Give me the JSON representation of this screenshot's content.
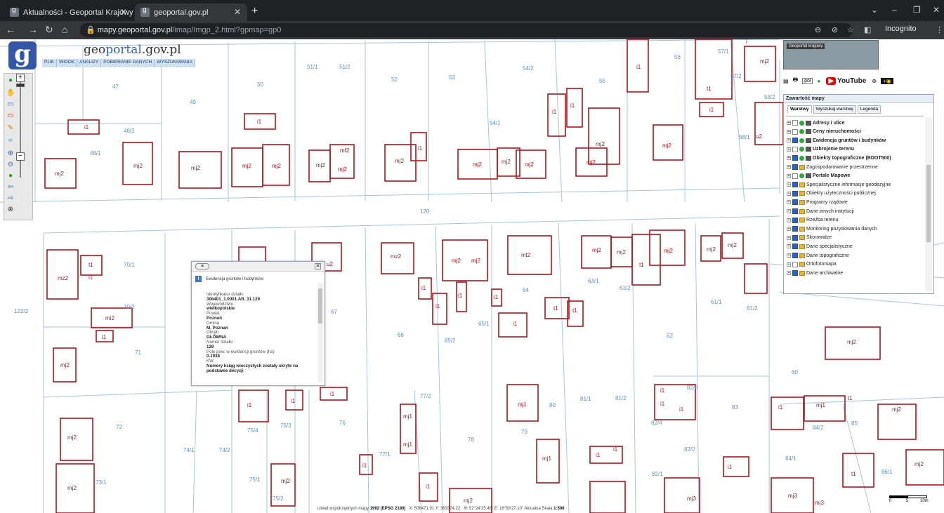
{
  "browser": {
    "tabs": [
      {
        "title": "Aktualności - Geoportal Krajowy"
      },
      {
        "title": "geoportal.gov.pl"
      }
    ],
    "url_host": "mapy.geoportal.gov.pl",
    "url_path": "/imap/Imgp_2.html?gpmap=gp0",
    "incognito_label": "Incognito"
  },
  "app": {
    "logo_letter": "g",
    "logo_text_a": "geo",
    "logo_text_b": "portal",
    "logo_text_c": ".gov.pl",
    "menu": [
      "PLIK",
      "WIDOK",
      "ANALIZY",
      "POBIERANIE DANYCH",
      "WYSZUKIWANIA"
    ]
  },
  "popup": {
    "section_title": "Ewidencja gruntów i budynków",
    "fields": [
      {
        "label": "Identyfikator działki",
        "value": "306401_1.0001.AR_31.129"
      },
      {
        "label": "Województwo",
        "value": "wielkopolskie"
      },
      {
        "label": "Powiat",
        "value": "Poznań"
      },
      {
        "label": "Gmina",
        "value": "M. Poznań"
      },
      {
        "label": "Obręb",
        "value": "GŁÓWNA"
      },
      {
        "label": "Numer działki",
        "value": "129"
      },
      {
        "label": "Pole pow. w ewidencji gruntów (ha)",
        "value": "0.1938"
      },
      {
        "label": "KW",
        "value": "Numery ksiąg wieczystych zostały ukryte na podstawie decyzji"
      }
    ]
  },
  "overview": {
    "label": "Geoportal krajowy"
  },
  "toolbar": {
    "lang": "pol",
    "youtube": "YouTube"
  },
  "panel": {
    "title": "Zawartość mapy",
    "tabs": [
      "Warstwy",
      "Wyszukaj warstwę",
      "Legenda"
    ],
    "layers": [
      {
        "name": "Adresy i ulice",
        "checked": false,
        "bold": true,
        "icon": "dot"
      },
      {
        "name": "Ceny nieruchomości",
        "checked": false,
        "bold": true,
        "icon": "dot"
      },
      {
        "name": "Ewidencja gruntów i budynków",
        "checked": true,
        "bold": true,
        "icon": "dot"
      },
      {
        "name": "Uzbrojenie terenu",
        "checked": false,
        "bold": true,
        "icon": "dot"
      },
      {
        "name": "Obiekty topograficzne (BDOT500)",
        "checked": true,
        "bold": true,
        "icon": "dot"
      },
      {
        "name": "Zagospodarowanie przestrzenne",
        "checked": true,
        "bold": false,
        "icon": "folder"
      },
      {
        "name": "Portale Mapowe",
        "checked": false,
        "bold": true,
        "icon": "dot"
      },
      {
        "name": "Specjalistyczne informacje geodezyjne",
        "checked": true,
        "bold": false,
        "icon": "folder"
      },
      {
        "name": "Obiekty użyteczności publicznej",
        "checked": true,
        "bold": false,
        "icon": "folder"
      },
      {
        "name": "Programy rządowe",
        "checked": true,
        "bold": false,
        "icon": "folder"
      },
      {
        "name": "Dane innych instytucji",
        "checked": true,
        "bold": false,
        "icon": "folder"
      },
      {
        "name": "Rzeźba terenu",
        "checked": true,
        "bold": false,
        "icon": "folder"
      },
      {
        "name": "Monitoring pozyskiwania danych",
        "checked": true,
        "bold": false,
        "icon": "folder"
      },
      {
        "name": "Skorowidze",
        "checked": true,
        "bold": false,
        "icon": "folder"
      },
      {
        "name": "Dane specjalistyczne",
        "checked": true,
        "bold": false,
        "icon": "folder"
      },
      {
        "name": "Dane topograficzne",
        "checked": true,
        "bold": false,
        "icon": "folder"
      },
      {
        "name": "Ortofotomapa",
        "checked": false,
        "bold": false,
        "icon": "folder"
      },
      {
        "name": "Dane archiwalne",
        "checked": true,
        "bold": false,
        "icon": "folder"
      }
    ]
  },
  "status": {
    "system_label": "Układ współrzędnych mapy",
    "system": "1992 (EPSG 2180)",
    "x_label": "X:",
    "x": "506471.91",
    "y_label": "Y:",
    "y": "363374.22",
    "n_label": "N:",
    "n": "52°24'25.48\"",
    "e_label": "E:",
    "e": "16°59'27.10\"",
    "scale_label": "Aktualna Skala",
    "scale": "1:500"
  },
  "scalebar": {
    "t0": "0",
    "t1": "5",
    "t2": "10m"
  },
  "map_parcels": [
    "47",
    "49",
    "50",
    "52",
    "53",
    "54/2",
    "55",
    "56",
    "57/1",
    "57/2",
    "58/2",
    "58/1",
    "48/2",
    "48/1",
    "51/1",
    "51/2",
    "54/1",
    "120",
    "70/1",
    "70/2",
    "122/2",
    "71",
    "72",
    "73/1",
    "74/1",
    "74/2",
    "75/4",
    "75/3",
    "75/1",
    "75/2",
    "76",
    "77/2",
    "77/1",
    "78",
    "79",
    "80",
    "81/1",
    "81/2",
    "82/4",
    "82/5",
    "82/2",
    "82/1",
    "83",
    "84/2",
    "84/1",
    "85",
    "86/1",
    "60",
    "61/1",
    "61/2",
    "62",
    "63/1",
    "63/2",
    "64",
    "65/1",
    "65/2",
    "66",
    "67"
  ],
  "map_buildings": [
    "mj2",
    "i1",
    "mz2",
    "t1",
    "mt2",
    "mj1",
    "mj3",
    "mi2",
    "u2",
    "i",
    "mf2"
  ]
}
